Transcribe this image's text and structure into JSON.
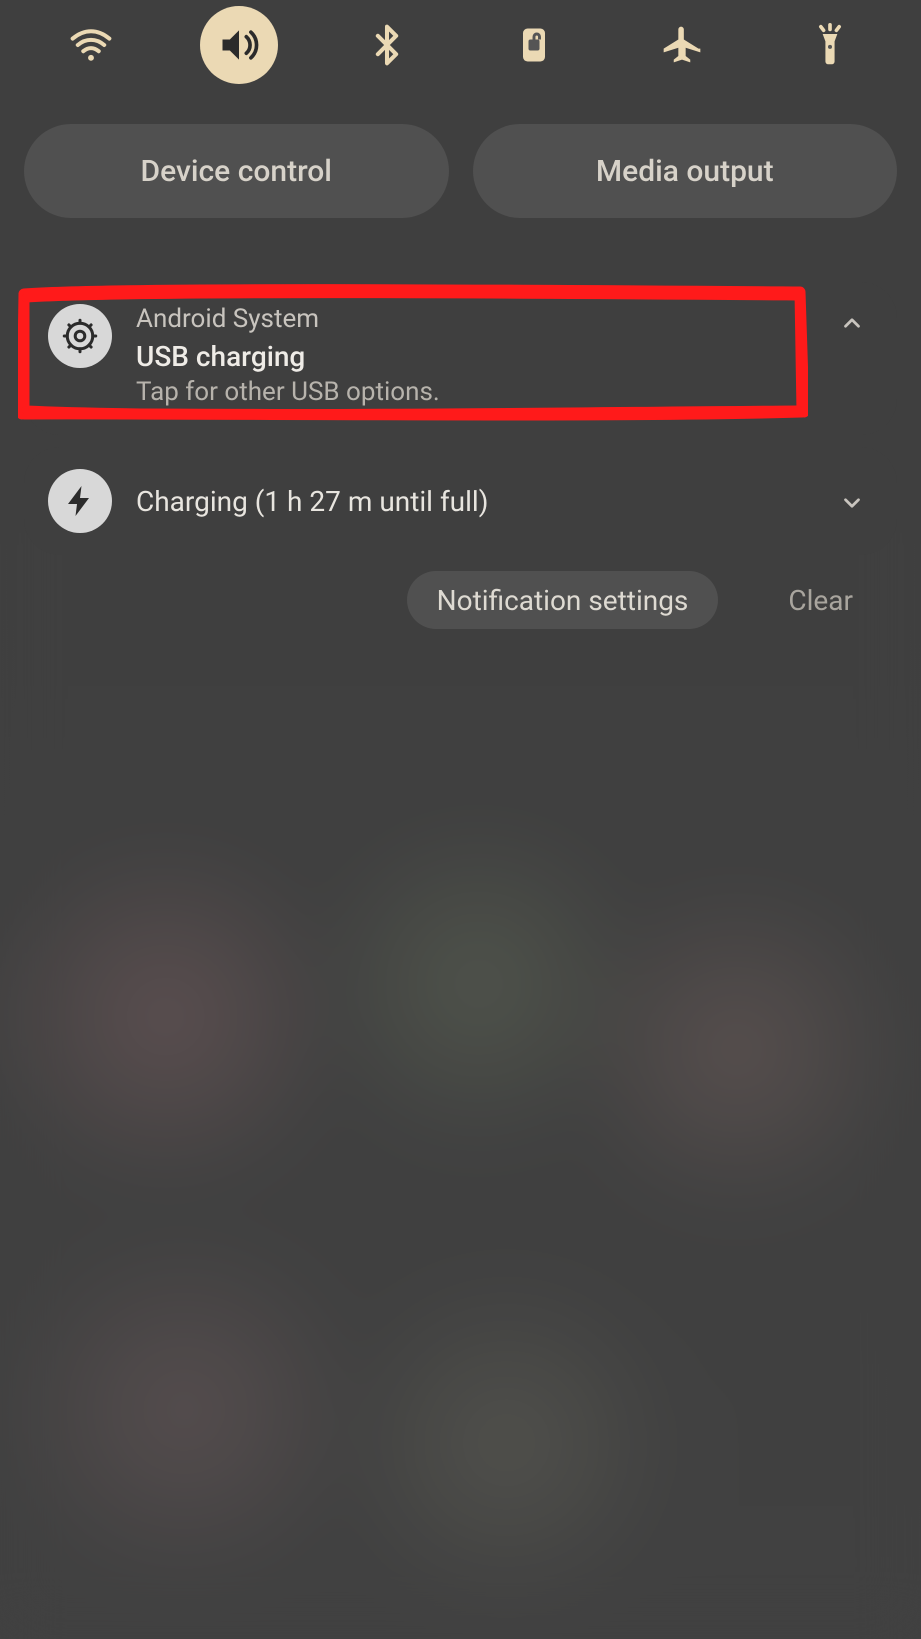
{
  "quick_settings": {
    "toggles": [
      {
        "name": "wifi",
        "active": false
      },
      {
        "name": "sound",
        "active": true
      },
      {
        "name": "bluetooth",
        "active": false
      },
      {
        "name": "rotation-lock",
        "active": false
      },
      {
        "name": "airplane-mode",
        "active": false
      },
      {
        "name": "flashlight",
        "active": false
      }
    ]
  },
  "pills": {
    "device_control": "Device control",
    "media_output": "Media output"
  },
  "notifications": [
    {
      "icon": "gear",
      "app": "Android System",
      "title": "USB charging",
      "subtitle": "Tap for other USB options.",
      "chevron": "up",
      "highlighted": true
    },
    {
      "icon": "bolt",
      "app": "",
      "title": "Charging (1 h 27 m until full)",
      "subtitle": "",
      "chevron": "down",
      "highlighted": false
    }
  ],
  "actions": {
    "settings": "Notification settings",
    "clear": "Clear"
  },
  "colors": {
    "accent": "#EBD9B4",
    "card": "#3f3f3f",
    "highlight": "#ff1a1a"
  }
}
